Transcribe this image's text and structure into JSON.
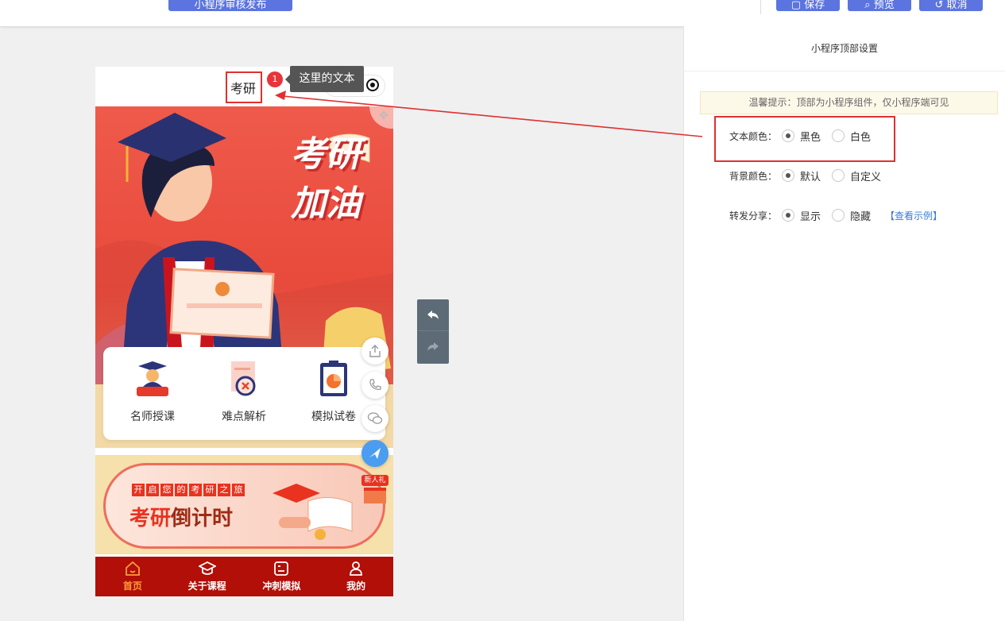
{
  "toolbar": {
    "publish_label": "小程序审核发布",
    "save_label": "保存",
    "preview_label": "预览",
    "cancel_label": "取消"
  },
  "phone": {
    "title": "考研",
    "menu": [
      {
        "label": "名师授课",
        "icon": "graduate-icon"
      },
      {
        "label": "难点解析",
        "icon": "document-search-icon"
      },
      {
        "label": "模拟试卷",
        "icon": "clipboard-icon"
      }
    ],
    "banner_title": "考研加油",
    "promo": {
      "tagline_chars": [
        "开",
        "启",
        "您",
        "的",
        "考",
        "研",
        "之",
        "旅"
      ],
      "headline_a": "考研",
      "headline_b": "倒计时",
      "gift_label": "新人礼"
    },
    "tabs": [
      {
        "label": "首页",
        "icon": "home-icon",
        "active": true
      },
      {
        "label": "关于课程",
        "icon": "mortarboard-icon",
        "active": false
      },
      {
        "label": "冲刺模拟",
        "icon": "practice-icon",
        "active": false
      },
      {
        "label": "我的",
        "icon": "user-icon",
        "active": false
      }
    ]
  },
  "annotation": {
    "badge": "1",
    "tooltip": "这里的文本"
  },
  "panel": {
    "title": "小程序顶部设置",
    "tip": "温馨提示：顶部为小程序组件，仅小程序端可见",
    "text_color": {
      "label": "文本颜色：",
      "options": [
        "黑色",
        "白色"
      ],
      "selected": "黑色"
    },
    "bg_color": {
      "label": "背景颜色：",
      "options": [
        "默认",
        "自定义"
      ],
      "selected": "默认"
    },
    "share": {
      "label": "转发分享：",
      "options": [
        "显示",
        "隐藏"
      ],
      "selected": "显示",
      "example_link": "【查看示例】"
    }
  },
  "colors": {
    "accent_blue": "#5b74e0",
    "highlight_red": "#e03030",
    "tabbar_red": "#b10f07",
    "tab_active": "#ff9b3b"
  }
}
